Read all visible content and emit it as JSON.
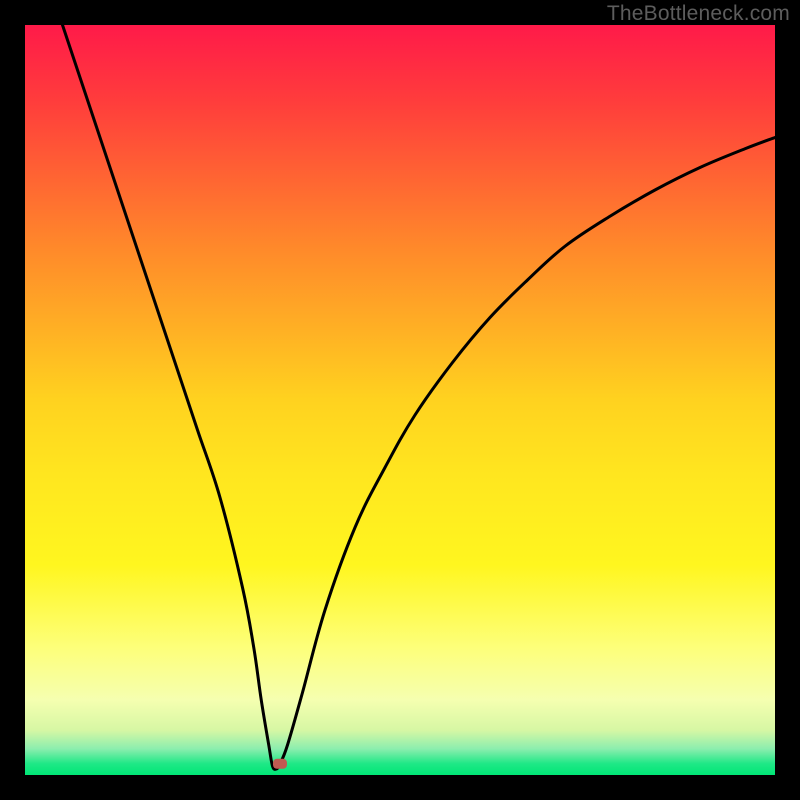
{
  "watermark": "TheBottleneck.com",
  "chart_data": {
    "type": "line",
    "title": "",
    "xlabel": "",
    "ylabel": "",
    "xlim": [
      0,
      100
    ],
    "ylim": [
      0,
      100
    ],
    "gradient_stops": [
      {
        "offset": 0.0,
        "color": "#ff1a49"
      },
      {
        "offset": 0.1,
        "color": "#ff3c3c"
      },
      {
        "offset": 0.3,
        "color": "#ff8a2a"
      },
      {
        "offset": 0.5,
        "color": "#ffd21f"
      },
      {
        "offset": 0.6,
        "color": "#ffe61f"
      },
      {
        "offset": 0.72,
        "color": "#fff61f"
      },
      {
        "offset": 0.83,
        "color": "#fdff7a"
      },
      {
        "offset": 0.9,
        "color": "#f5ffb0"
      },
      {
        "offset": 0.94,
        "color": "#d7f7a4"
      },
      {
        "offset": 0.965,
        "color": "#8ceeae"
      },
      {
        "offset": 0.985,
        "color": "#1ee886"
      },
      {
        "offset": 1.0,
        "color": "#00e676"
      }
    ],
    "curve": {
      "x": [
        5,
        8,
        11,
        14,
        17,
        20,
        23,
        26,
        29,
        30.5,
        31.5,
        32.5,
        33,
        33.5,
        34,
        35,
        37,
        40,
        44,
        48,
        52,
        57,
        62,
        67,
        72,
        78,
        84,
        90,
        96,
        100
      ],
      "y": [
        100,
        91,
        82,
        73,
        64,
        55,
        46,
        37,
        25,
        17,
        10,
        4,
        1.2,
        0.8,
        1.5,
        4,
        11,
        22,
        33,
        41,
        48,
        55,
        61,
        66,
        70.5,
        74.5,
        78,
        81,
        83.5,
        85
      ]
    },
    "marker": {
      "x": 34.0,
      "y": 1.5,
      "color": "#c05a52"
    }
  }
}
